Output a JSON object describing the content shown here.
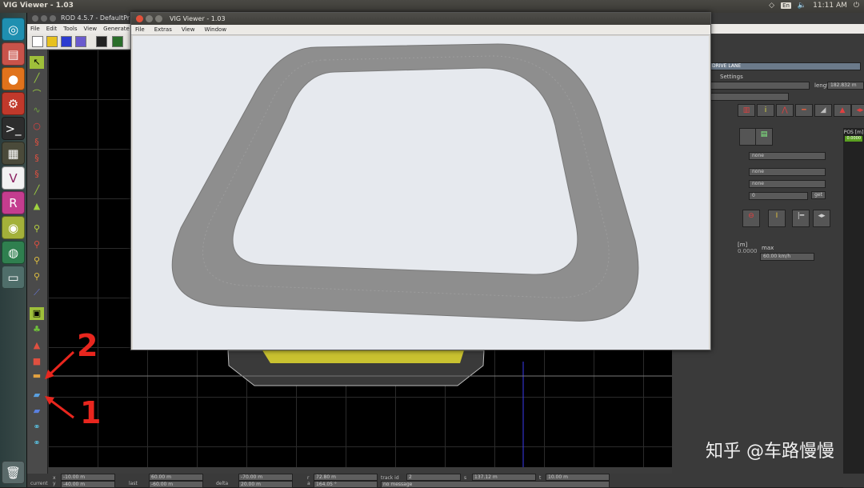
{
  "topbar": {
    "title": "VIG Viewer - 1.03",
    "kbd": "En",
    "time": "11:11 AM"
  },
  "launcher": {
    "items": [
      {
        "name": "ubuntu-dash-icon",
        "glyph": "◎",
        "color": "#1f8fb0"
      },
      {
        "name": "files-icon",
        "glyph": "▤",
        "color": "#c8534a"
      },
      {
        "name": "firefox-icon",
        "glyph": "●",
        "color": "#e0731c"
      },
      {
        "name": "settings-icon",
        "glyph": "⚙",
        "color": "#c0392b"
      },
      {
        "name": "terminal-icon",
        "glyph": ">_",
        "color": "#2d2d2d"
      },
      {
        "name": "monitor-icon",
        "glyph": "▦",
        "color": "#4a4a3a"
      },
      {
        "name": "vires-icon",
        "glyph": "V",
        "color": "#f2f2f2"
      },
      {
        "name": "rod-icon",
        "glyph": "R",
        "color": "#c43d8f"
      },
      {
        "name": "camera-icon",
        "glyph": "◉",
        "color": "#a3b13a"
      },
      {
        "name": "globe-icon",
        "glyph": "◍",
        "color": "#2f7f4f"
      },
      {
        "name": "window-icon",
        "glyph": "▭",
        "color": "#4f6e6a"
      }
    ]
  },
  "rod": {
    "title": "ROD 4.5.7 - DefaultPr",
    "menu": [
      "File",
      "Edit",
      "Tools",
      "View",
      "Generate"
    ],
    "panel": {
      "header": "DRIVE LANE",
      "settings": "Settings",
      "length_label": "length",
      "length_value": "182.832 m",
      "pos_label": "POS [m]",
      "pos_value": "0.0000",
      "field1": "none",
      "field2": "none",
      "field3": "none",
      "field4": "0",
      "get_label": "get",
      "min_label": "[m]",
      "min_value": "0.0000",
      "max_label": "max",
      "max_value": "60.00  km/h"
    },
    "status": {
      "current": "current",
      "last": "last",
      "delta": "delta",
      "x1": "-10.00 m",
      "y1": "-40.00 m",
      "x2": "60.00 m",
      "y2": "-60.00 m",
      "x3": "-70.00 m",
      "y3": "20.00 m",
      "r": "72.80 m",
      "a": "164.05 °",
      "track_id_label": "track id",
      "track_id": "2",
      "s_label": "s",
      "s": "137.12 m",
      "t_label": "t",
      "t": "10.00 m",
      "message": "no message"
    }
  },
  "vig": {
    "title": "VIG Viewer - 1.03",
    "menu": [
      "File",
      "Extras",
      "View",
      "Window"
    ]
  },
  "annotations": {
    "label_2": "2",
    "label_1": "1"
  },
  "watermark": "知乎 @车路慢慢"
}
